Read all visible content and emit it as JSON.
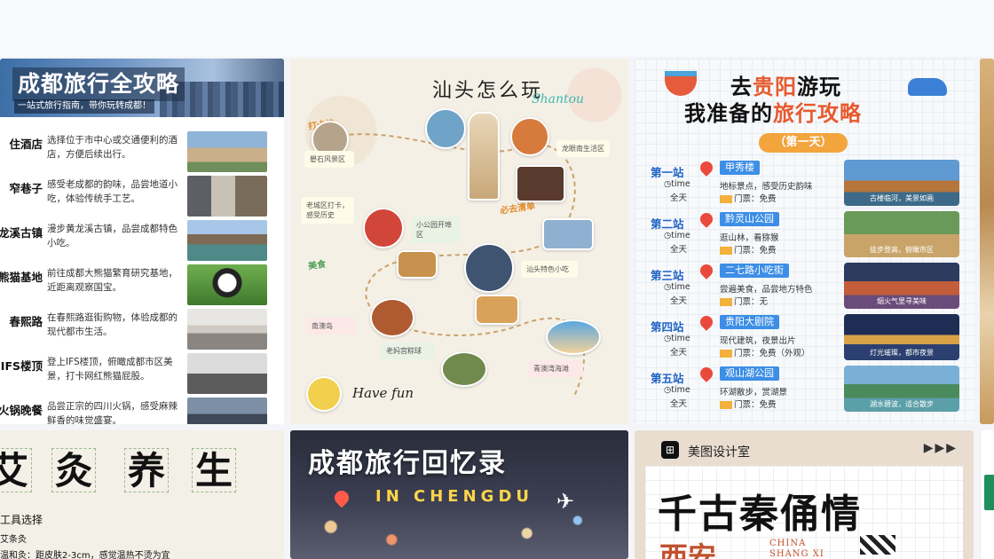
{
  "cards": {
    "chengdu_guide": {
      "title": "成都旅行全攻略",
      "subtitle": "一站式旅行指南，带你玩转成都！",
      "rows": [
        {
          "name": "住酒店",
          "desc": "选择位于市中心或交通便利的酒店，方便后续出行。"
        },
        {
          "name": "窄巷子",
          "desc": "感受老成都的韵味，品尝地道小吃，体验传统手工艺。"
        },
        {
          "name": "黄龙溪古镇",
          "desc": "漫步黄龙溪古镇，品尝成都特色小吃。"
        },
        {
          "name": "熊猫基地",
          "desc": "前往成都大熊猫繁育研究基地，近距离观察国宝。"
        },
        {
          "name": "春熙路",
          "desc": "在春熙路逛街购物，体验成都的现代都市生活。"
        },
        {
          "name": "IFS楼顶",
          "desc": "登上IFS楼顶，俯瞰成都市区美景，打卡网红熊猫屁股。"
        },
        {
          "name": "火锅晚餐",
          "desc": "品尝正宗的四川火锅，感受麻辣鲜香的味觉盛宴。"
        }
      ]
    },
    "shantou": {
      "title": "汕头怎么玩",
      "title_en": "Shantou",
      "tags": [
        "打卡地",
        "必去清单",
        "美食"
      ],
      "notes": [
        "老城区打卡，感受历史",
        "小公园开埠区",
        "南澳岛",
        "汕头特色小吃",
        "老妈宫粽球",
        "青澳湾海滩",
        "礐石风景区",
        "龙眼南生活区"
      ],
      "have_fun": "Have fun"
    },
    "guiyang": {
      "title_pre": "去",
      "title_hl": "贵阳",
      "title_post": "游玩",
      "title2_pre": "我准备的",
      "title2_hl": "旅行攻略",
      "day": "（第一天）",
      "stops": [
        {
          "label": "第一站",
          "place": "甲秀楼",
          "time": "time",
          "allday": "全天",
          "act": "地标景点，感受历史韵味",
          "ticket": "门票：免费",
          "cap": "古楼临河，美景如画"
        },
        {
          "label": "第二站",
          "place": "黔灵山公园",
          "time": "time",
          "allday": "全天",
          "act": "逛山林，看猕猴",
          "ticket": "门票：免费",
          "cap": "徒步登高，俯瞰市区"
        },
        {
          "label": "第三站",
          "place": "二七路小吃街",
          "time": "time",
          "allday": "全天",
          "act": "尝遍美食，品尝地方特色",
          "ticket": "门票：无",
          "cap": "烟火气里寻美味"
        },
        {
          "label": "第四站",
          "place": "贵阳大剧院",
          "time": "time",
          "allday": "全天",
          "act": "现代建筑，夜景出片",
          "ticket": "门票：免费（外观）",
          "cap": "灯光璀璨，都市夜景"
        },
        {
          "label": "第五站",
          "place": "观山湖公园",
          "time": "time",
          "allday": "全天",
          "act": "环湖散步，赏湖景",
          "ticket": "门票：免费",
          "cap": "湖水碧波，适合散步"
        }
      ]
    },
    "moxibustion": {
      "chars": [
        "艾",
        "灸",
        "养",
        "生"
      ],
      "line1": "工具选择",
      "line2": "艾条灸",
      "line3": "温和灸：距皮肤2-3cm，感觉温热不烫为宜"
    },
    "chengdu_memory": {
      "title": "成都旅行回忆录",
      "sub": "IN CHENGDU"
    },
    "qin": {
      "brand": "美图设计室",
      "arrows": "▶▶▶",
      "big": "千古秦俑情",
      "city": "西安",
      "en1": "CHINA",
      "en2": "SHANG XI"
    }
  }
}
